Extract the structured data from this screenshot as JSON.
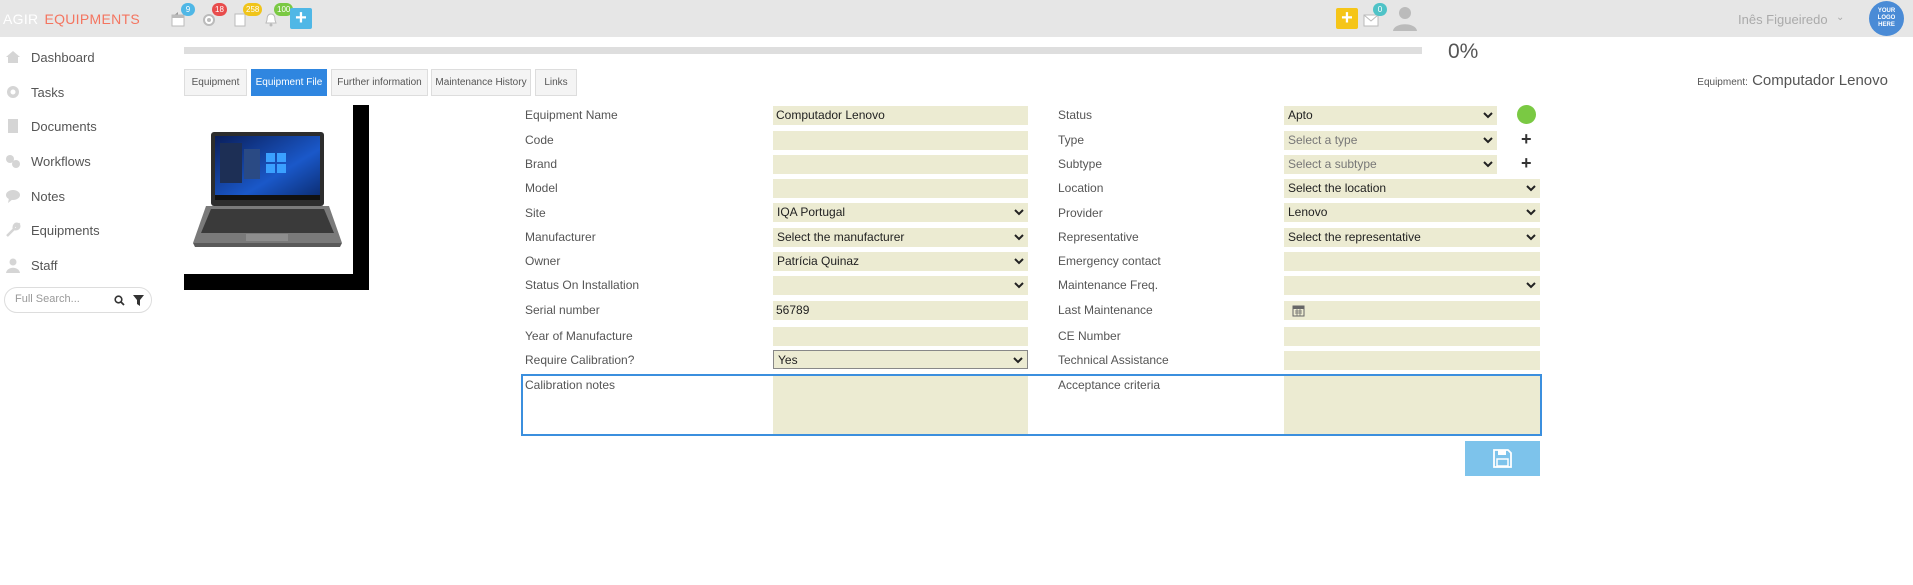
{
  "header": {
    "brand_prefix": "AGIR",
    "brand_module": "EQUIPMENTS",
    "badges": {
      "calendar": "9",
      "settings": "18",
      "documents": "258",
      "notifications": "100",
      "messages": "0"
    },
    "user_name": "Inês Figueiredo",
    "logo_text": [
      "YOUR",
      "LOGO",
      "HERE"
    ]
  },
  "sidebar": {
    "items": [
      {
        "label": "Dashboard",
        "icon": "home-icon"
      },
      {
        "label": "Tasks",
        "icon": "gear-icon"
      },
      {
        "label": "Documents",
        "icon": "document-icon"
      },
      {
        "label": "Workflows",
        "icon": "workflow-icon"
      },
      {
        "label": "Notes",
        "icon": "comments-icon"
      },
      {
        "label": "Equipments",
        "icon": "wrench-icon"
      },
      {
        "label": "Staff",
        "icon": "user-icon"
      }
    ],
    "search_placeholder": "Full Search..."
  },
  "progress": {
    "value": 0,
    "label": "0%"
  },
  "tabs": [
    "Equipment",
    "Equipment File",
    "Further information",
    "Maintenance History",
    "Links"
  ],
  "active_tab": "Equipment File",
  "equipment_title": {
    "label": "Equipment:",
    "value": "Computador Lenovo"
  },
  "form": {
    "left": [
      {
        "label": "Equipment Name",
        "value": "Computador Lenovo"
      },
      {
        "label": "Code",
        "value": ""
      },
      {
        "label": "Brand",
        "value": ""
      },
      {
        "label": "Model",
        "value": ""
      },
      {
        "label": "Site",
        "value": "IQA Portugal"
      },
      {
        "label": "Manufacturer",
        "value": "Select the manufacturer"
      },
      {
        "label": "Owner",
        "value": "Patrícia Quinaz"
      },
      {
        "label": "Status On Installation",
        "value": ""
      },
      {
        "label": "Serial number",
        "value": "56789"
      },
      {
        "label": "Year of Manufacture",
        "value": ""
      },
      {
        "label": "Require Calibration?",
        "value": "Yes"
      },
      {
        "label": "Calibration notes",
        "value": ""
      }
    ],
    "right": [
      {
        "label": "Status",
        "value": "Apto"
      },
      {
        "label": "Type",
        "value": "Select a type"
      },
      {
        "label": "Subtype",
        "value": "Select a subtype"
      },
      {
        "label": "Location",
        "value": "Select the location"
      },
      {
        "label": "Provider",
        "value": "Lenovo"
      },
      {
        "label": "Representative",
        "value": "Select the representative"
      },
      {
        "label": "Emergency contact",
        "value": ""
      },
      {
        "label": "Maintenance Freq.",
        "value": ""
      },
      {
        "label": "Last Maintenance",
        "value": ""
      },
      {
        "label": "CE Number",
        "value": ""
      },
      {
        "label": "Technical Assistance",
        "value": ""
      },
      {
        "label": "Acceptance criteria",
        "value": ""
      }
    ]
  },
  "colors": {
    "accent_blue": "#2f86e0",
    "field_bg": "#ecebd2",
    "brand_orange": "#f47560",
    "status_green": "#7ac943"
  }
}
